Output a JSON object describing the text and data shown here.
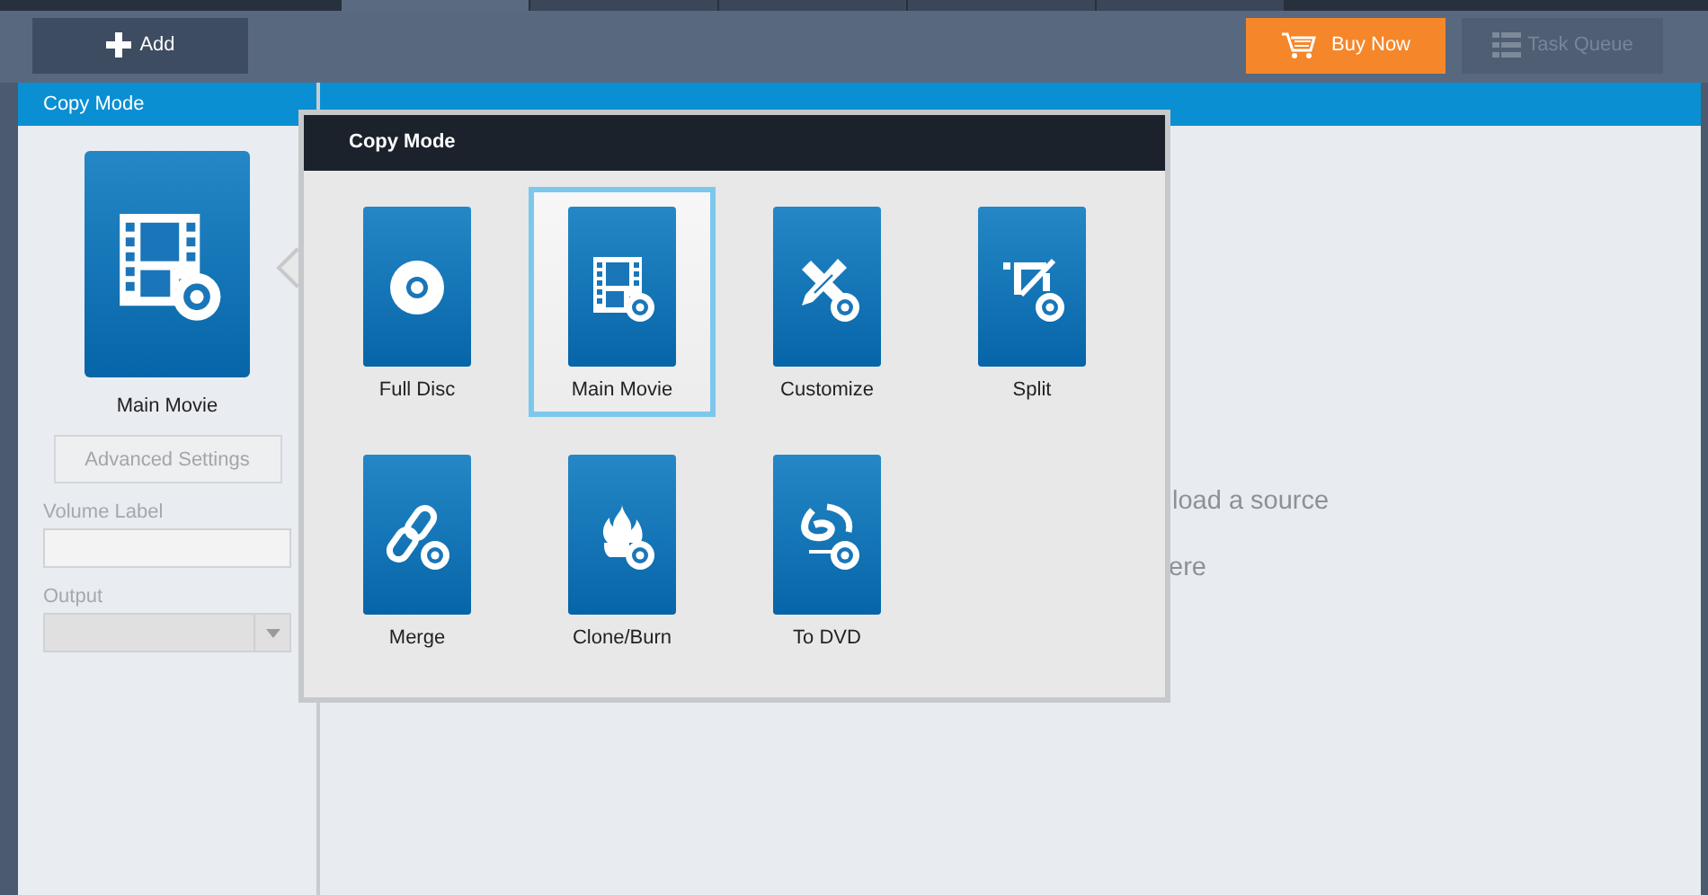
{
  "tabs": [
    {
      "selected": true
    },
    {
      "selected": false
    },
    {
      "selected": false
    },
    {
      "selected": false
    },
    {
      "selected": false
    }
  ],
  "toolbar": {
    "add": "Add",
    "buy": "Buy Now",
    "queue": {
      "label": "Task Queue",
      "disabled": true
    }
  },
  "sidebar": {
    "header": "Copy Mode",
    "mode_label": "Main Movie",
    "advanced": {
      "label": "Advanced Settings",
      "disabled": true
    },
    "volume_label": "Volume Label",
    "output_label": "Output"
  },
  "main": {
    "hint_1": "load a source",
    "hint_2": "ere"
  },
  "popup": {
    "title": "Copy Mode",
    "modes": [
      {
        "label": "Full Disc",
        "selected": false
      },
      {
        "label": "Main Movie",
        "selected": true
      },
      {
        "label": "Customize",
        "selected": false
      },
      {
        "label": "Split",
        "selected": false
      },
      {
        "label": "Merge",
        "selected": false
      },
      {
        "label": "Clone/Burn",
        "selected": false
      },
      {
        "label": "To DVD",
        "selected": false
      }
    ]
  }
}
